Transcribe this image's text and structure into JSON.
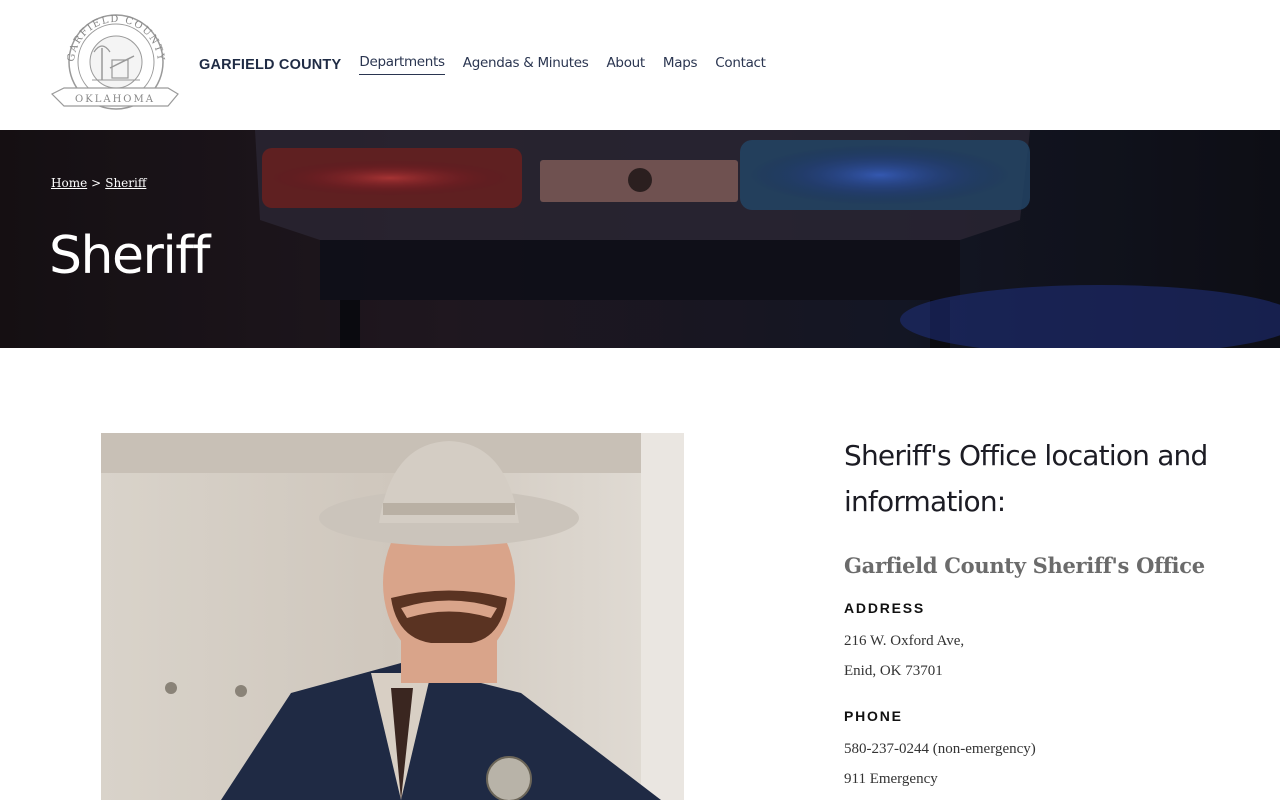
{
  "header": {
    "seal": {
      "top_text": "GARFIELD COUNTY",
      "bottom_text": "OKLAHOMA",
      "icon": "county-seal-icon"
    },
    "brand": "GARFIELD COUNTY",
    "nav": [
      {
        "label": "Departments",
        "active": true
      },
      {
        "label": "Agendas & Minutes",
        "active": false
      },
      {
        "label": "About",
        "active": false
      },
      {
        "label": "Maps",
        "active": false
      },
      {
        "label": "Contact",
        "active": false
      }
    ]
  },
  "hero": {
    "breadcrumb": {
      "home": "Home",
      "separator": ">",
      "current": "Sheriff"
    },
    "title": "Sheriff"
  },
  "info": {
    "heading": "Sheriff's Office location and information:",
    "office_name": "Garfield County Sheriff's Office",
    "address_label": "ADDRESS",
    "address_line1": "216 W. Oxford Ave,",
    "address_line2": "Enid, OK 73701",
    "phone_label": "PHONE",
    "phone_line1": "580-237-0244 (non-emergency)",
    "phone_line2": "911 Emergency"
  },
  "colors": {
    "nav_text": "#2a3550",
    "hero_bg": "#201a22",
    "office_name": "#6b6b6b"
  }
}
